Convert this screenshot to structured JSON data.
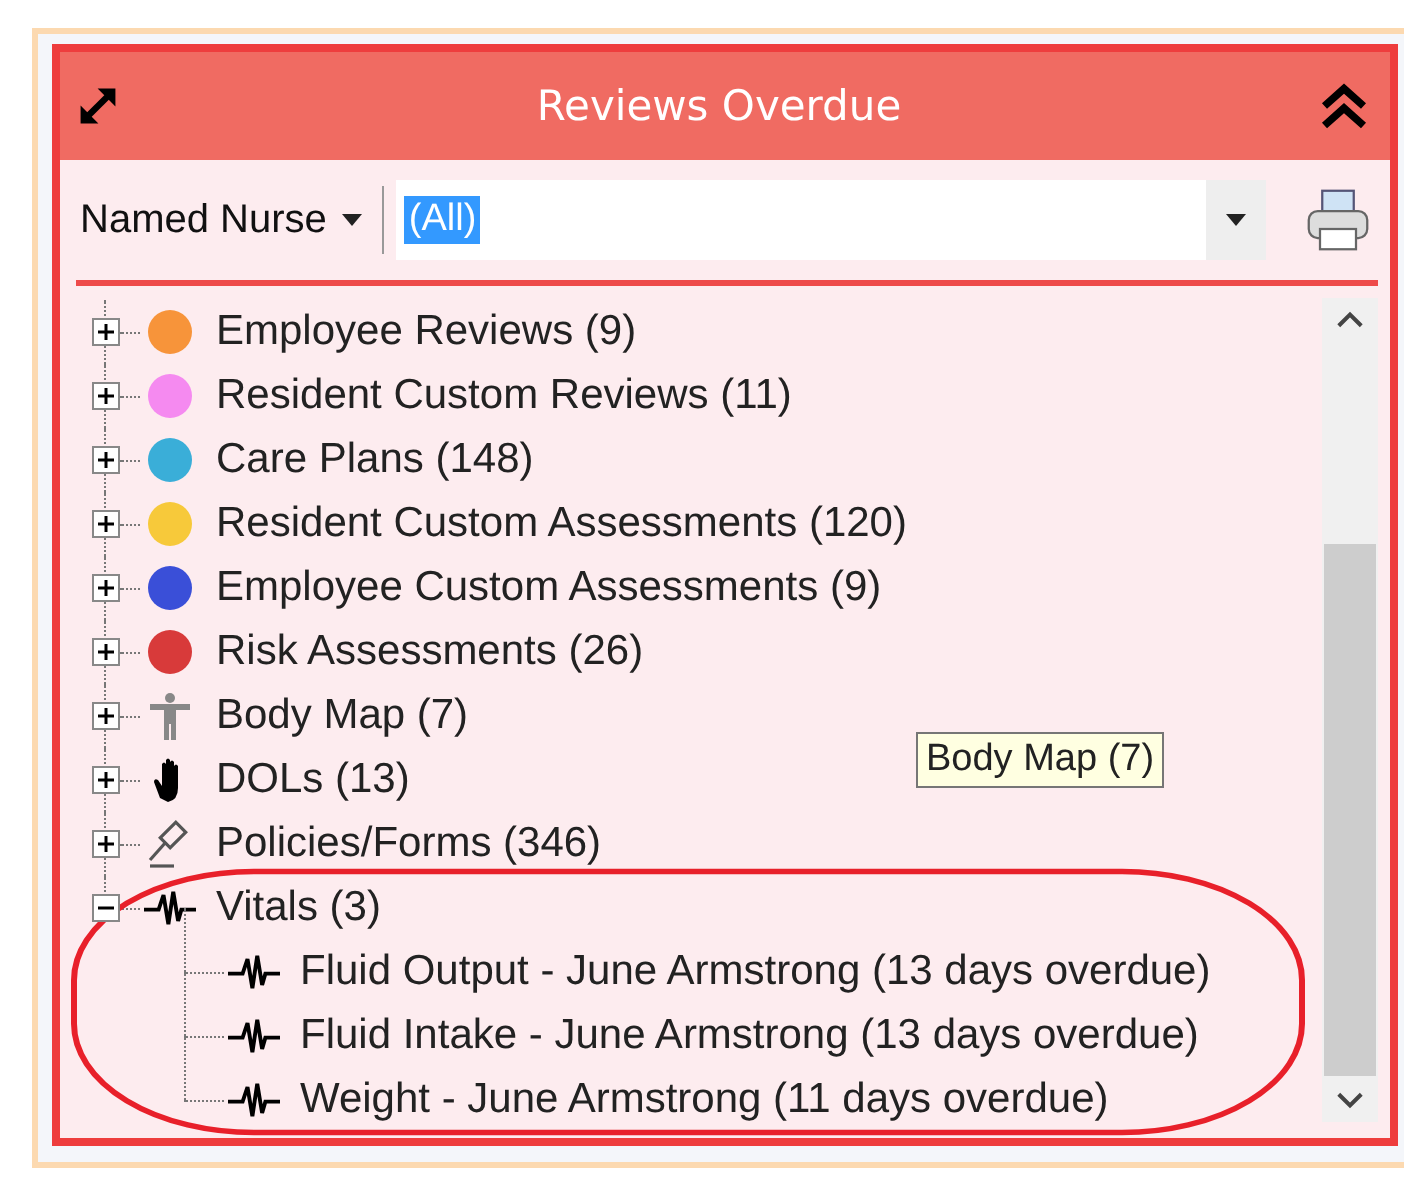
{
  "window": {
    "title": "Reviews Overdue"
  },
  "filter": {
    "label": "Named Nurse",
    "value": "(All)",
    "highlighted": true
  },
  "tree": [
    {
      "label": "Employee Reviews (9)",
      "kind": "dot",
      "color": "#f7943a",
      "expanded": false
    },
    {
      "label": "Resident Custom Reviews (11)",
      "kind": "dot",
      "color": "#f58af0",
      "expanded": false
    },
    {
      "label": "Care Plans (148)",
      "kind": "dot",
      "color": "#3aaed8",
      "expanded": false
    },
    {
      "label": "Resident Custom Assessments (120)",
      "kind": "dot",
      "color": "#f7c93a",
      "expanded": false
    },
    {
      "label": "Employee Custom Assessments (9)",
      "kind": "dot",
      "color": "#3a4fd8",
      "expanded": false
    },
    {
      "label": "Risk Assessments (26)",
      "kind": "dot",
      "color": "#d83a3a",
      "expanded": false
    },
    {
      "label": "Body Map (7)",
      "kind": "figure",
      "expanded": false
    },
    {
      "label": "DOLs (13)",
      "kind": "hand",
      "expanded": false
    },
    {
      "label": "Policies/Forms (346)",
      "kind": "gavel",
      "expanded": false
    },
    {
      "label": "Vitals (3)",
      "kind": "pulse",
      "expanded": true,
      "children": [
        {
          "label": "Fluid Output - June Armstrong (13 days overdue)",
          "kind": "pulse"
        },
        {
          "label": "Fluid Intake - June Armstrong (13 days overdue)",
          "kind": "pulse"
        },
        {
          "label": "Weight - June Armstrong (11 days overdue)",
          "kind": "pulse"
        }
      ]
    }
  ],
  "tooltip": "Body Map (7)"
}
